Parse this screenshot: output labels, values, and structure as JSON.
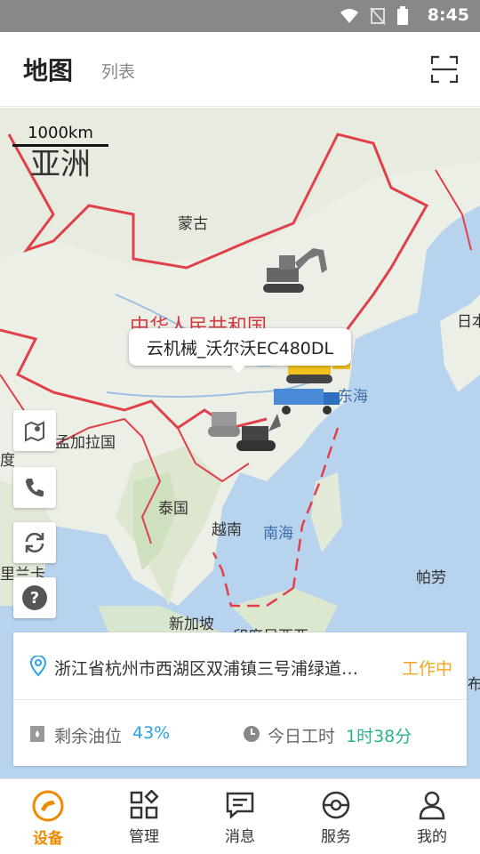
{
  "status_bar": {
    "time": "8:45"
  },
  "header": {
    "tab_map": "地图",
    "tab_list": "列表",
    "scan_icon": "scan-icon"
  },
  "map": {
    "scale_label": "1000km",
    "continent_label": "亚洲",
    "labels": {
      "mongolia": "蒙古",
      "china": "中华人民共和国",
      "japan": "日本",
      "east_sea": "东海",
      "bangladesh": "孟加拉国",
      "india": "度",
      "thailand": "泰国",
      "vietnam": "越南",
      "south_sea": "南海",
      "sri_lanka": "里兰卡",
      "palau": "帕劳",
      "singapore": "新加坡",
      "indonesia": "印度尼西亚",
      "right_edge": "布"
    },
    "tooltip": "云机械_沃尔沃EC480DL",
    "controls": [
      "map-pin-icon",
      "phone-icon",
      "refresh-icon",
      "help-icon"
    ]
  },
  "info_card": {
    "address": "浙江省杭州市西湖区双浦镇三号浦绿道…",
    "status": "工作中",
    "fuel_label": "剩余油位",
    "fuel_value": "43%",
    "hours_label": "今日工时",
    "hours_value": "1时38分"
  },
  "nav": [
    {
      "label": "设备",
      "icon": "device-icon",
      "active": true
    },
    {
      "label": "管理",
      "icon": "grid-icon",
      "active": false
    },
    {
      "label": "消息",
      "icon": "message-icon",
      "active": false
    },
    {
      "label": "服务",
      "icon": "service-icon",
      "active": false
    },
    {
      "label": "我的",
      "icon": "user-icon",
      "active": false
    }
  ],
  "colors": {
    "accent": "#f08a00",
    "status_working": "#f5a623",
    "fuel": "#2aa2e8",
    "hours": "#2bb38a",
    "border_red": "#e0404a"
  }
}
